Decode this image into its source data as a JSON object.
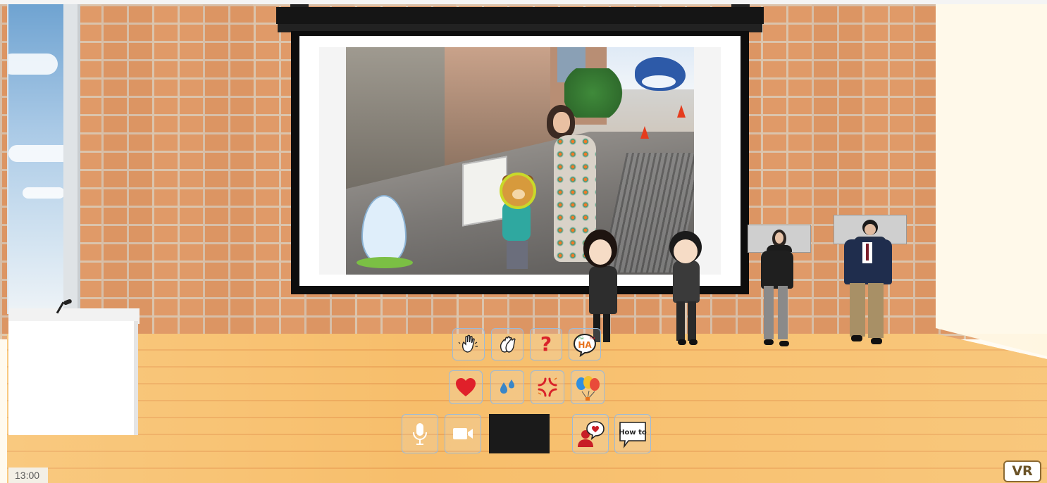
{
  "hud": {
    "clock": "13:00",
    "vr_label": "VR"
  },
  "reactions": {
    "row1": [
      "hand-raise",
      "clap",
      "question",
      "laugh"
    ],
    "row2": [
      "heart",
      "sweat",
      "angry",
      "balloons"
    ],
    "question_glyph": "?",
    "laugh_text": "HA"
  },
  "toolbar": {
    "items": [
      "microphone",
      "camera",
      "chat",
      "how-to"
    ],
    "howto_label": "How to"
  },
  "colors": {
    "button_border": "#9bbad8",
    "heart": "#e0202a",
    "question": "#d9232a",
    "sweat": "#3a86c8",
    "vr_border": "#8b6a34"
  }
}
